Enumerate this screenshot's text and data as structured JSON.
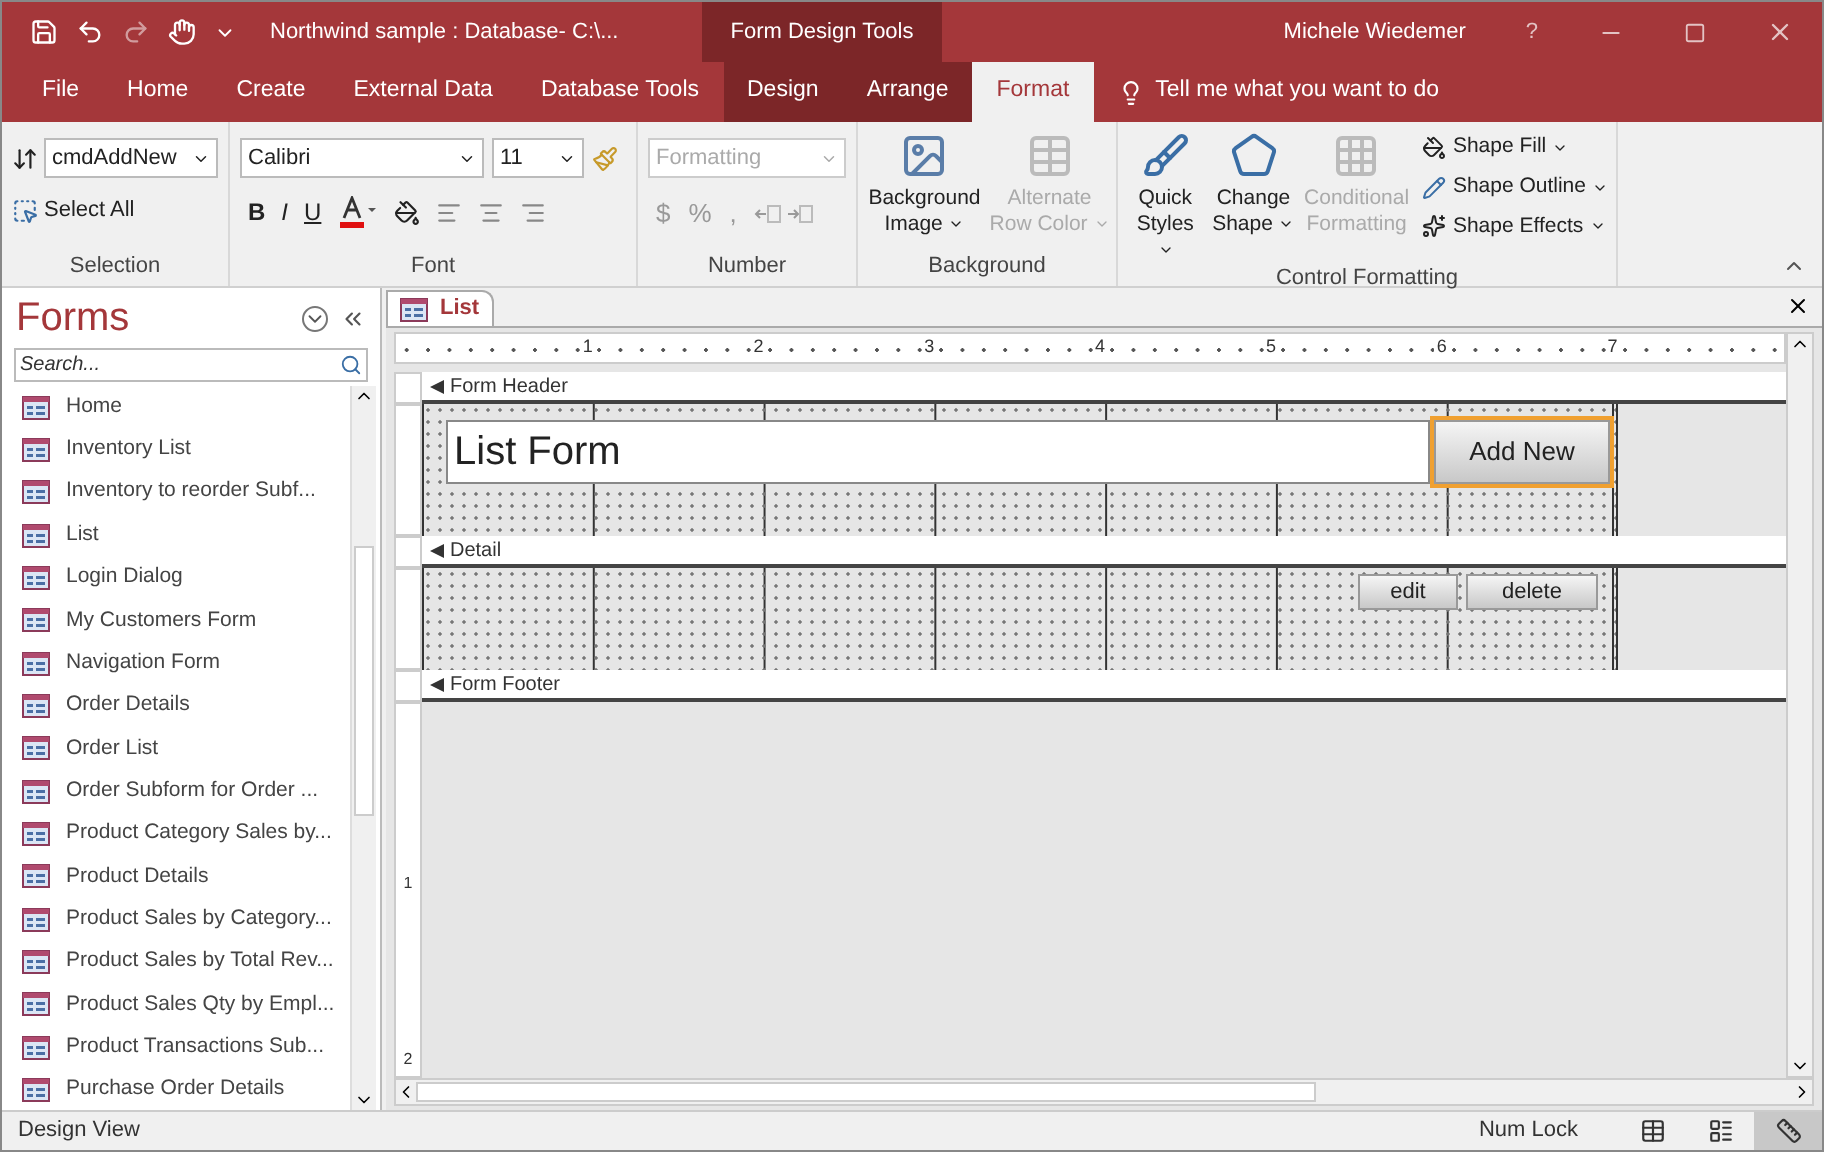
{
  "title_bar": {
    "title": "Northwind sample : Database- C:\\...",
    "context_group": "Form Design Tools",
    "user": "Michele Wiedemer",
    "help": "?"
  },
  "tabs": [
    {
      "label": "File",
      "selected": false,
      "contextual": false
    },
    {
      "label": "Home",
      "selected": false,
      "contextual": false
    },
    {
      "label": "Create",
      "selected": false,
      "contextual": false
    },
    {
      "label": "External Data",
      "selected": false,
      "contextual": false
    },
    {
      "label": "Database Tools",
      "selected": false,
      "contextual": false
    },
    {
      "label": "Design",
      "selected": false,
      "contextual": true
    },
    {
      "label": "Arrange",
      "selected": false,
      "contextual": true
    },
    {
      "label": "Format",
      "selected": true,
      "contextual": true
    }
  ],
  "tell_me": "Tell me what you want to do",
  "ribbon": {
    "selection": {
      "label": "Selection",
      "object": "cmdAddNew",
      "select_all": "Select All"
    },
    "font": {
      "label": "Font",
      "family": "Calibri",
      "size": "11",
      "bold": "B",
      "italic": "I",
      "underline": "U"
    },
    "number": {
      "label": "Number",
      "format": "Formatting",
      "currency": "$",
      "percent": "%",
      "comma": ","
    },
    "background": {
      "label": "Background",
      "buttons": [
        {
          "label": "Background Image",
          "disabled": false
        },
        {
          "label": "Alternate Row Color",
          "disabled": true
        }
      ]
    },
    "control_formatting": {
      "label": "Control Formatting",
      "buttons": [
        {
          "label": "Quick Styles",
          "disabled": false
        },
        {
          "label": "Change Shape",
          "disabled": false
        },
        {
          "label": "Conditional Formatting",
          "disabled": true
        }
      ],
      "shape_commands": [
        "Shape Fill",
        "Shape Outline",
        "Shape Effects"
      ]
    }
  },
  "navigation_pane": {
    "title": "Forms",
    "search_placeholder": "Search...",
    "items": [
      "Home",
      "Inventory List",
      "Inventory to reorder Subf...",
      "List",
      "Login Dialog",
      "My Customers Form",
      "Navigation Form",
      "Order Details",
      "Order List",
      "Order Subform for Order ...",
      "Product Category Sales by...",
      "Product Details",
      "Product Sales by Category...",
      "Product Sales by Total Rev...",
      "Product Sales Qty by Empl...",
      "Product Transactions Sub...",
      "Purchase Order Details"
    ]
  },
  "document_tab": {
    "label": "List"
  },
  "ruler": [
    "1",
    "2",
    "3",
    "4",
    "5",
    "6",
    "7"
  ],
  "vertical_ruler": [
    "1",
    "2"
  ],
  "sections": [
    {
      "label": "Form Header",
      "kind": "header",
      "controls": [
        {
          "kind": "label",
          "text": "List Form",
          "selected": false
        },
        {
          "kind": "button",
          "text": "Add New",
          "selected": true
        }
      ]
    },
    {
      "label": "Detail",
      "kind": "detail",
      "controls": [
        {
          "kind": "button",
          "text": "edit",
          "selected": false
        },
        {
          "kind": "button",
          "text": "delete",
          "selected": false
        }
      ]
    },
    {
      "label": "Form Footer",
      "kind": "footer"
    }
  ],
  "status_bar": {
    "view": "Design View",
    "num_lock": "Num Lock",
    "views": [
      {
        "selected": false
      },
      {
        "selected": false
      },
      {
        "selected": true
      }
    ]
  }
}
